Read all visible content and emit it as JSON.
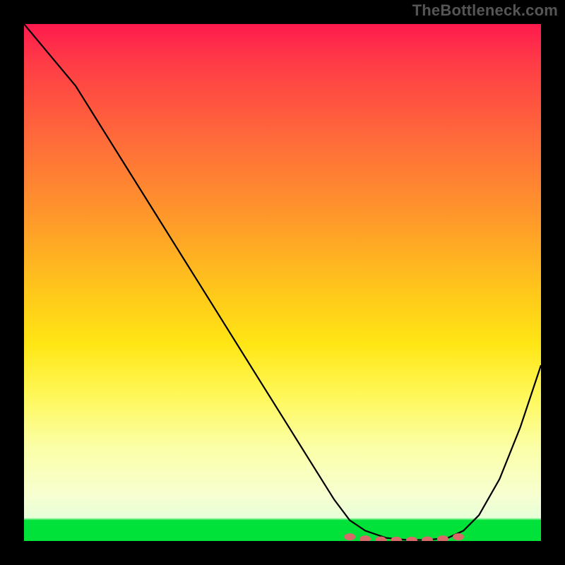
{
  "attribution": "TheBottleneck.com",
  "chart_data": {
    "type": "line",
    "title": "",
    "xlabel": "",
    "ylabel": "",
    "xlim": [
      0,
      100
    ],
    "ylim": [
      0,
      100
    ],
    "grid": false,
    "legend": false,
    "background": {
      "type": "vertical-gradient",
      "stops": [
        {
          "pos": 0,
          "color": "#ff1a4d"
        },
        {
          "pos": 22,
          "color": "#ff6a3a"
        },
        {
          "pos": 52,
          "color": "#ffc81a"
        },
        {
          "pos": 72,
          "color": "#fff85a"
        },
        {
          "pos": 95,
          "color": "#e8ffd8"
        },
        {
          "pos": 100,
          "color": "#00e23a"
        }
      ]
    },
    "series": [
      {
        "name": "bottleneck-curve",
        "color": "#000000",
        "x": [
          0,
          5,
          10,
          15,
          20,
          25,
          30,
          35,
          40,
          45,
          50,
          55,
          60,
          63,
          66,
          70,
          74,
          78,
          82,
          85,
          88,
          92,
          96,
          100
        ],
        "y": [
          100,
          94,
          88,
          80,
          72,
          64,
          56,
          48,
          40,
          32,
          24,
          16,
          8,
          4,
          2,
          0.6,
          0.2,
          0.2,
          0.6,
          2,
          5,
          12,
          22,
          34
        ]
      }
    ],
    "markers": {
      "name": "optimal-zone-dots",
      "color": "#d96a6a",
      "x": [
        63,
        66,
        69,
        72,
        75,
        78,
        81,
        84
      ],
      "y": [
        0.8,
        0.4,
        0.2,
        0.15,
        0.15,
        0.2,
        0.4,
        0.8
      ]
    }
  }
}
